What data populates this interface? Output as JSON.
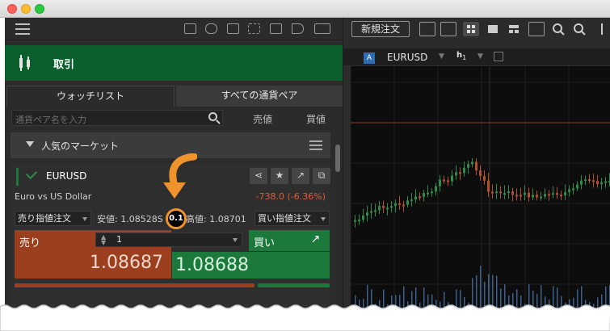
{
  "left": {
    "header_title": "取引",
    "tabs": [
      "ウォッチリスト",
      "すべての通貨ペア"
    ],
    "search_placeholder": "通貨ペア名を入力",
    "col_sell": "売値",
    "col_buy": "買値",
    "group_label": "人気のマーケット"
  },
  "instrument": {
    "symbol": "EURUSD",
    "description": "Euro vs US Dollar",
    "change": "-738.0 (-6.36%)",
    "sell_order_type": "売り指値注文",
    "low_text": "安値: 1.08528S",
    "spread": "0.1",
    "high_text": "高値: 1.08701",
    "buy_order_type": "買い指値注文",
    "sell_label": "売り",
    "buy_label": "買い",
    "quantity": "1",
    "sell_price": "1.08687",
    "buy_price": "1.08688"
  },
  "chart_panel": {
    "new_order_button": "新規注文",
    "symbol": "EURUSD",
    "series_badge": "A",
    "timeframe": "h",
    "timeframe_sub": "1"
  },
  "colors": {
    "green": "#1b7a3b",
    "red": "#9b3f1e",
    "accent_orange": "#f0932b"
  }
}
